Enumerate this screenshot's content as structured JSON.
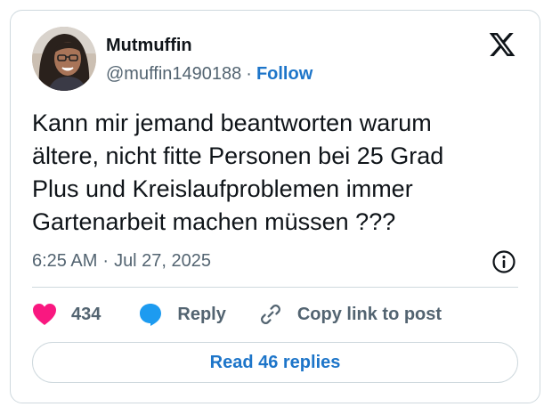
{
  "author": {
    "name": "Mutmuffin",
    "handle": "@muffin1490188",
    "separator": "·",
    "follow_label": "Follow"
  },
  "tweet": {
    "text": "Kann mir jemand beantworten warum\nältere, nicht fitte Personen bei 25 Grad\nPlus und Kreislaufproblemen immer\nGartenarbeit machen müssen ???",
    "time": "6:25 AM",
    "separator": "·",
    "date": "Jul 27, 2025"
  },
  "actions": {
    "likes_count": "434",
    "reply_label": "Reply",
    "copy_label": "Copy link to post"
  },
  "read_replies_label": "Read 46 replies",
  "icons": {
    "brand": "x-logo-icon",
    "info": "info-icon",
    "like": "heart-icon",
    "reply": "speech-bubble-icon",
    "copy": "link-icon"
  },
  "colors": {
    "like": "#f91880",
    "reply": "#1d9bf0",
    "link_text": "#1d75c9",
    "muted_text": "#536471",
    "border": "#cfd9de"
  }
}
